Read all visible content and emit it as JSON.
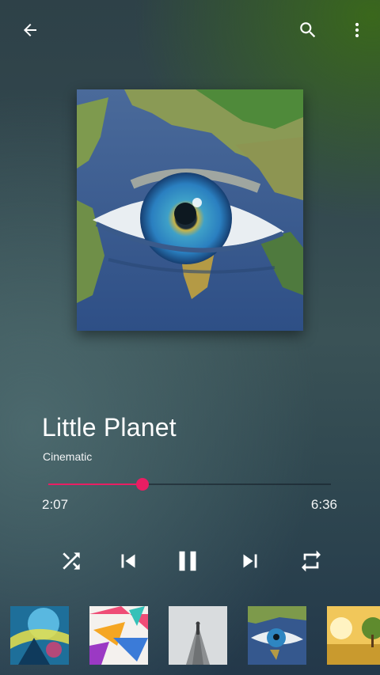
{
  "toolbar": {
    "back_icon": "arrow-back-icon",
    "search_icon": "search-icon",
    "more_icon": "more-vert-icon"
  },
  "now_playing": {
    "title": "Little Planet",
    "artist": "Cinematic",
    "elapsed": "2:07",
    "duration": "6:36",
    "progress": 0.3333
  },
  "controls": {
    "shuffle_icon": "shuffle-icon",
    "previous_icon": "skip-previous-icon",
    "play_pause_icon": "pause-icon",
    "next_icon": "skip-next-icon",
    "repeat_icon": "repeat-icon"
  },
  "colors": {
    "accent": "#e91e63"
  },
  "queue": [
    {
      "thumbnail": "abstract-blue-figure-artwork"
    },
    {
      "thumbnail": "colorful-abstract-shapes-artwork"
    },
    {
      "thumbnail": "person-on-foggy-pier-artwork"
    },
    {
      "thumbnail": "earth-eye-artwork"
    },
    {
      "thumbnail": "golden-field-tree-artwork"
    }
  ]
}
